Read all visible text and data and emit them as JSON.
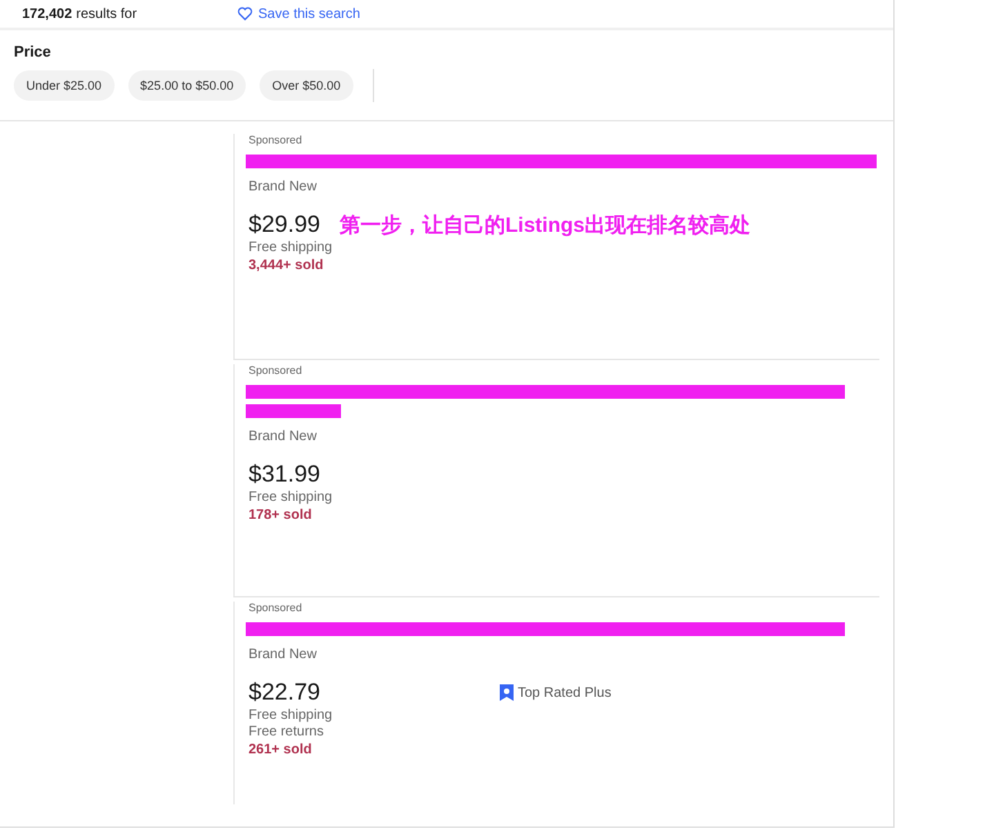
{
  "header": {
    "result_count": "172,402",
    "results_label": "results for",
    "save_search": "Save this search"
  },
  "price_filter": {
    "title": "Price",
    "options": [
      {
        "label": "Under $25.00"
      },
      {
        "label": "$25.00 to $50.00"
      },
      {
        "label": "Over $50.00"
      }
    ]
  },
  "listings": [
    {
      "sponsored": "Sponsored",
      "redactions": [
        {
          "kind": "full"
        }
      ],
      "condition": "Brand New",
      "price": "$29.99",
      "annotation": "第一步，让自己的Listings出现在排名较高处",
      "details": [
        "Free shipping"
      ],
      "sold": "3,444+ sold"
    },
    {
      "sponsored": "Sponsored",
      "redactions": [
        {
          "kind": "long"
        },
        {
          "kind": "short"
        }
      ],
      "condition": "Brand New",
      "price": "$31.99",
      "details": [
        "Free shipping"
      ],
      "sold": "178+ sold"
    },
    {
      "sponsored": "Sponsored",
      "redactions": [
        {
          "kind": "long"
        }
      ],
      "condition": "Brand New",
      "price": "$22.79",
      "badge": "Top Rated Plus",
      "details": [
        "Free shipping",
        "Free returns"
      ],
      "sold": "261+ sold"
    }
  ]
}
